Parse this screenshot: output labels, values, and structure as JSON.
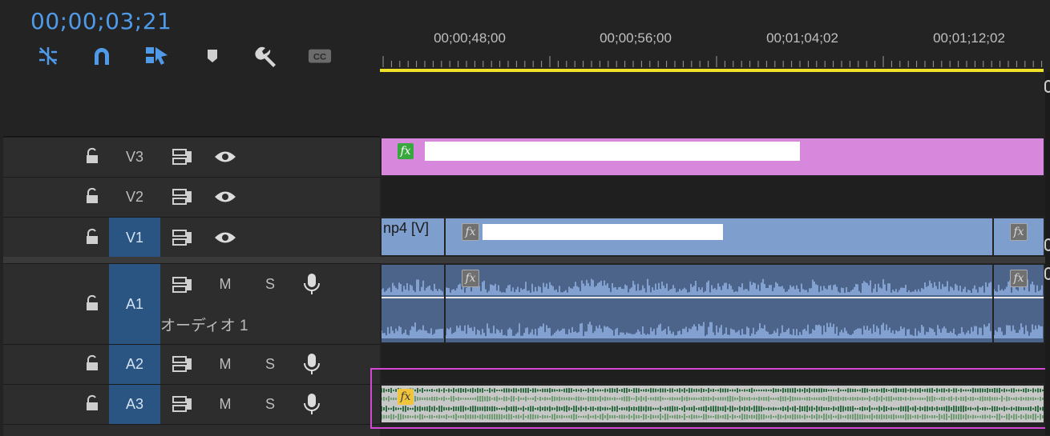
{
  "timecode": "00;00;03;21",
  "toolbar": {
    "icons": [
      "snap-linked-icon",
      "magnet-icon",
      "linked-selection-icon",
      "marker-icon",
      "wrench-icon",
      "captions-icon"
    ],
    "captions_label": "CC"
  },
  "ruler": {
    "labels": [
      "00;00;48;00",
      "00;00;56;00",
      "00;01;04;02",
      "00;01;12;02"
    ]
  },
  "tracks": {
    "v3": {
      "name": "V3"
    },
    "v2": {
      "name": "V2"
    },
    "v1": {
      "name": "V1"
    },
    "a1": {
      "name": "A1",
      "label": "オーディオ 1",
      "mute": "M",
      "solo": "S"
    },
    "a2": {
      "name": "A2",
      "mute": "M",
      "solo": "S"
    },
    "a3": {
      "name": "A3",
      "mute": "M",
      "solo": "S"
    }
  },
  "clips": {
    "v1_left_name": "np4 [V]",
    "fx_label": "fx"
  },
  "colors": {
    "accent_timecode": "#4f9bea",
    "work_area": "#f1e02a",
    "graphic_clip": "#d787dc",
    "video_clip": "#7e9fce",
    "audio_clip": "#4d648a",
    "selected_track": "#2a5582",
    "selection_box": "#d349d3"
  }
}
